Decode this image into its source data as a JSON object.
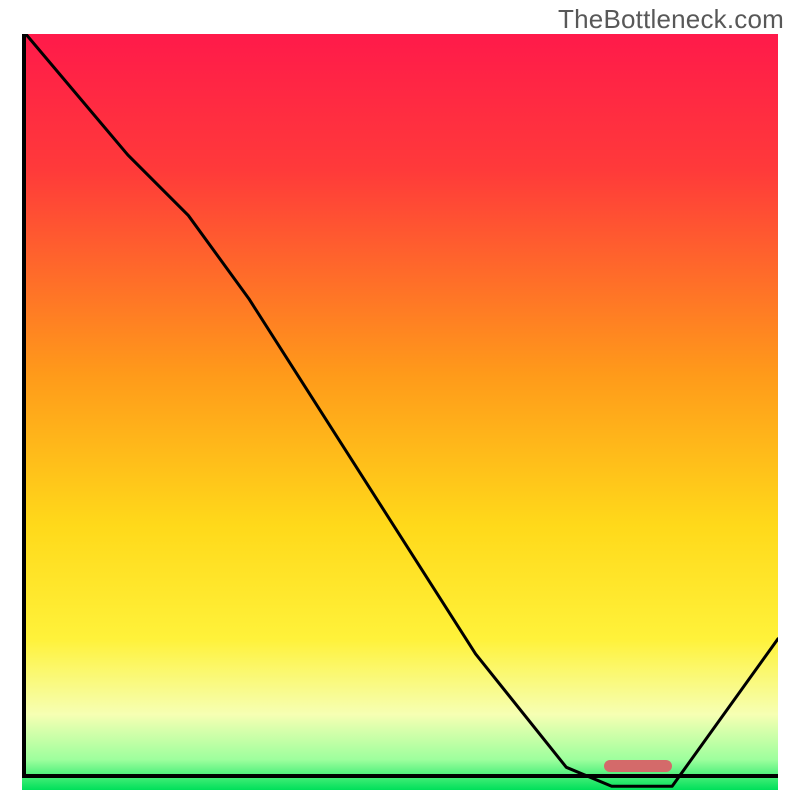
{
  "watermark": "TheBottleneck.com",
  "chart_data": {
    "type": "line",
    "title": "",
    "xlabel": "",
    "ylabel": "",
    "xlim": [
      0,
      100
    ],
    "ylim": [
      0,
      100
    ],
    "gradient_stops": [
      {
        "pos": 0,
        "color": "#ff1a4a"
      },
      {
        "pos": 18,
        "color": "#ff3a3a"
      },
      {
        "pos": 45,
        "color": "#ff9a1a"
      },
      {
        "pos": 65,
        "color": "#ffd91a"
      },
      {
        "pos": 80,
        "color": "#fff23a"
      },
      {
        "pos": 90,
        "color": "#f6ffb3"
      },
      {
        "pos": 96,
        "color": "#9dff9d"
      },
      {
        "pos": 100,
        "color": "#00e05a"
      }
    ],
    "curve_points": [
      {
        "x": 0.5,
        "y": 100
      },
      {
        "x": 14,
        "y": 84
      },
      {
        "x": 22,
        "y": 76
      },
      {
        "x": 30,
        "y": 65
      },
      {
        "x": 60,
        "y": 18
      },
      {
        "x": 72,
        "y": 3
      },
      {
        "x": 78,
        "y": 0.5
      },
      {
        "x": 86,
        "y": 0.5
      },
      {
        "x": 100,
        "y": 20
      }
    ],
    "highlight_marker": {
      "x_start": 77,
      "x_end": 86,
      "y": 0.5
    },
    "grid": false,
    "legend": false
  }
}
